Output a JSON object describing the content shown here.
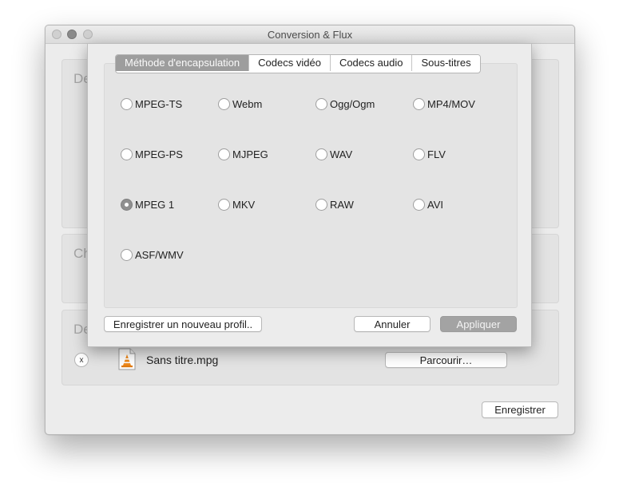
{
  "window": {
    "title": "Conversion & Flux",
    "groups": [
      {
        "label_fragment": "De"
      },
      {
        "label_fragment": "Ch"
      },
      {
        "label_fragment": "De"
      }
    ],
    "destination": {
      "file_name": "Sans titre.mpg",
      "remove_label": "x",
      "browse_label": "Parcourir…"
    },
    "save_label": "Enregistrer"
  },
  "sheet": {
    "tabs": [
      {
        "label": "Méthode d'encapsulation",
        "selected": true
      },
      {
        "label": "Codecs vidéo",
        "selected": false
      },
      {
        "label": "Codecs audio",
        "selected": false
      },
      {
        "label": "Sous-titres",
        "selected": false
      }
    ],
    "formats": [
      {
        "label": "MPEG-TS",
        "checked": false
      },
      {
        "label": "Webm",
        "checked": false
      },
      {
        "label": "Ogg/Ogm",
        "checked": false
      },
      {
        "label": "MP4/MOV",
        "checked": false
      },
      {
        "label": "MPEG-PS",
        "checked": false
      },
      {
        "label": "MJPEG",
        "checked": false
      },
      {
        "label": "WAV",
        "checked": false
      },
      {
        "label": "FLV",
        "checked": false
      },
      {
        "label": "MPEG 1",
        "checked": true
      },
      {
        "label": "MKV",
        "checked": false
      },
      {
        "label": "RAW",
        "checked": false
      },
      {
        "label": "AVI",
        "checked": false
      },
      {
        "label": "ASF/WMV",
        "checked": false
      }
    ],
    "save_profile_label": "Enregistrer un nouveau profil..",
    "cancel_label": "Annuler",
    "apply_label": "Appliquer"
  },
  "icons": {
    "file_icon": "vlc-cone-file-icon",
    "remove_icon": "close-icon"
  },
  "colors": {
    "selected_tab": "#9d9d9d",
    "disabled_button": "#a3a3a3",
    "cone_orange": "#f08a1c"
  }
}
